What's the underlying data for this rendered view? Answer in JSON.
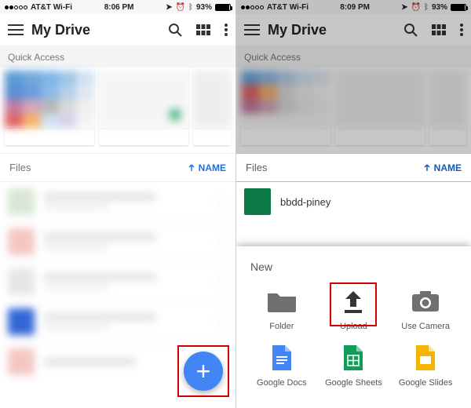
{
  "status": {
    "carrier": "AT&T Wi-Fi",
    "time_left": "8:06 PM",
    "time_right": "8:09 PM",
    "battery_pct": "93%"
  },
  "header": {
    "title": "My Drive"
  },
  "sections": {
    "quick_access": "Quick Access",
    "files": "Files",
    "sort_label": "NAME"
  },
  "files_right": {
    "visible_name": "bbdd-piney"
  },
  "fab": {
    "glyph": "+"
  },
  "sheet": {
    "title": "New",
    "items_row1": [
      {
        "id": "folder",
        "label": "Folder"
      },
      {
        "id": "upload",
        "label": "Upload"
      },
      {
        "id": "camera",
        "label": "Use Camera"
      }
    ],
    "items_row2": [
      {
        "id": "docs",
        "label": "Google Docs"
      },
      {
        "id": "sheets",
        "label": "Google Sheets"
      },
      {
        "id": "slides",
        "label": "Google Slides"
      }
    ]
  },
  "colors": {
    "accent": "#1a73e8",
    "fab": "#4285f4",
    "highlight": "#d40000",
    "docs": "#4285f4",
    "sheets": "#0f9d58",
    "slides": "#f4b400"
  }
}
